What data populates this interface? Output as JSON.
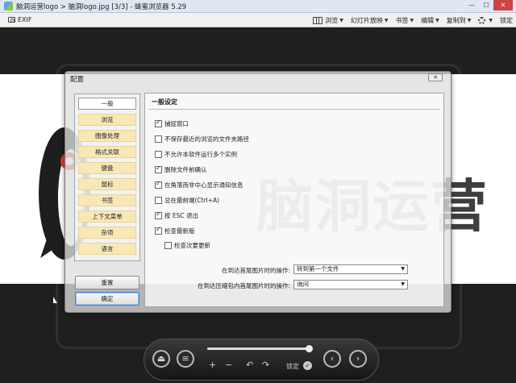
{
  "window": {
    "title": "脑洞运营logo > 脑洞logo.jpg [3/3] - 蜂蜜浏览器 5.29",
    "minimize": "—",
    "maximize": "☐",
    "close": "✕"
  },
  "toolbar": {
    "exif_label": "EXIF",
    "items": [
      {
        "label": "浏览"
      },
      {
        "label": "幻灯片放映"
      },
      {
        "label": "书签"
      },
      {
        "label": "编辑"
      },
      {
        "label": "复制到"
      }
    ],
    "lock_label": "锁定"
  },
  "watermark_text": "脑洞运营",
  "dialog": {
    "title": "配置",
    "close_label": "✕",
    "nav_items": [
      {
        "label": "一般",
        "active": true
      },
      {
        "label": "浏览"
      },
      {
        "label": "图像处理"
      },
      {
        "label": "格式关联"
      },
      {
        "label": "键盘"
      },
      {
        "label": "鼠标"
      },
      {
        "label": "书签"
      },
      {
        "label": "上下文菜单"
      },
      {
        "label": "杂项"
      },
      {
        "label": "语言"
      }
    ],
    "reset_label": "重置",
    "ok_label": "确定",
    "section_title": "一般设定",
    "options": [
      {
        "label": "捕捉窗口",
        "checked": true
      },
      {
        "label": "不保存最近的浏览的文件夹路径",
        "checked": false
      },
      {
        "label": "不允许本软件运行多个实例",
        "checked": false
      },
      {
        "label": "删除文件前确认",
        "checked": true
      },
      {
        "label": "在角落而非中心显示通知信息",
        "checked": true
      },
      {
        "label": "总在最前端(Ctrl+A)",
        "checked": false
      },
      {
        "label": "按 ESC 退出",
        "checked": true
      },
      {
        "label": "检查最新版",
        "checked": true
      },
      {
        "label": "检查次要更新",
        "checked": false
      }
    ],
    "selects": [
      {
        "label": "在到达首尾图片时的操作:",
        "value": "转到第一个文件"
      },
      {
        "label": "在到达压缩包内首尾图片时的操作:",
        "value": "询问"
      }
    ]
  },
  "controls": {
    "slider_position": 0.97,
    "zoom_in": "+",
    "zoom_out": "−",
    "rotate_left": "↶",
    "rotate_right": "↷",
    "lock_label": "锁定",
    "prev": "‹",
    "next": "›"
  }
}
